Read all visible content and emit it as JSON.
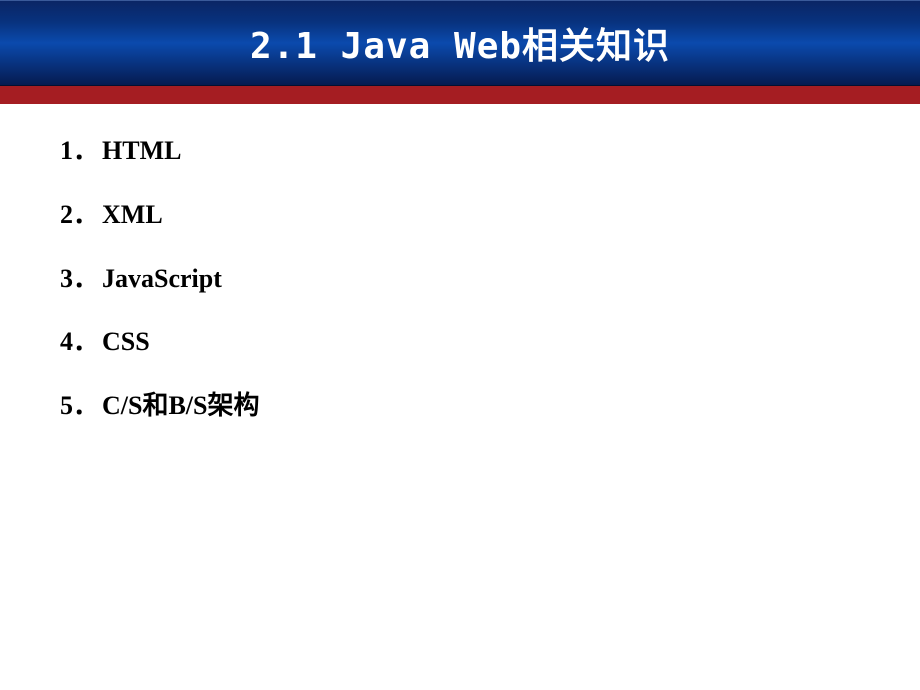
{
  "header": {
    "title": "2.1 Java Web相关知识"
  },
  "list": {
    "items": [
      {
        "number": "1．",
        "text": "HTML"
      },
      {
        "number": "2．",
        "text": "XML"
      },
      {
        "number": "3．",
        "text": "JavaScript"
      },
      {
        "number": "4．",
        "text": "CSS"
      },
      {
        "number": "5．",
        "text": "C/S和B/S架构"
      }
    ]
  }
}
